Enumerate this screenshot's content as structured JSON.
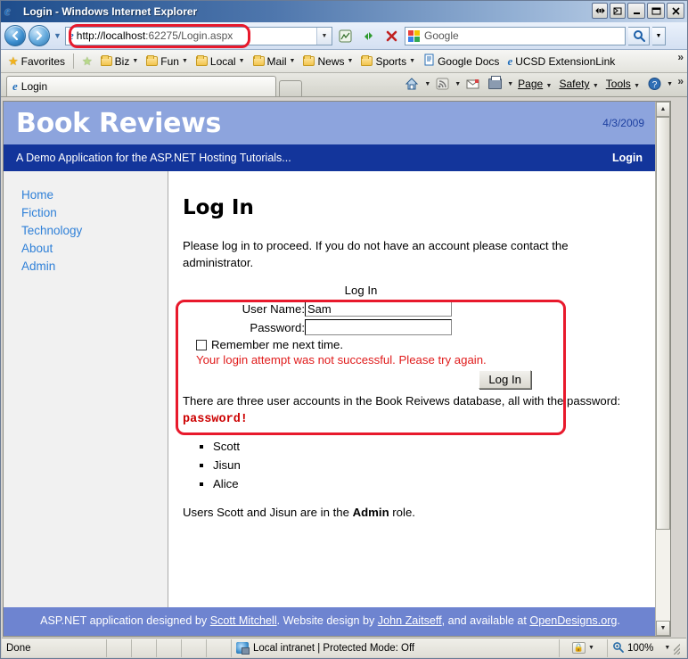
{
  "window": {
    "title": "Login - Windows Internet Explorer",
    "icon": "ie-icon",
    "buttons": {
      "restore_down": "restore-down",
      "min": "minimize",
      "max": "maximize",
      "close": "close"
    }
  },
  "browser": {
    "back_label": "Back",
    "forward_label": "Forward",
    "history_dropdown": "History",
    "address": {
      "scheme": "http://localhost",
      "rest": ":62275/Login.aspx",
      "full": "http://localhost:62275/Login.aspx"
    },
    "compat_button": "Compatibility View",
    "refresh_button": "Refresh",
    "stop_button": "Stop",
    "search": {
      "placeholder": "Google",
      "provider_icon": "google-icon",
      "go_label": "Search"
    },
    "favorites_label": "Favorites",
    "favorites": [
      {
        "label": "Biz",
        "icon": "folder-icon",
        "has_caret": true
      },
      {
        "label": "Fun",
        "icon": "folder-icon",
        "has_caret": true
      },
      {
        "label": "Local",
        "icon": "folder-icon",
        "has_caret": true
      },
      {
        "label": "Mail",
        "icon": "folder-icon",
        "has_caret": true
      },
      {
        "label": "News",
        "icon": "folder-icon",
        "has_caret": true
      },
      {
        "label": "Sports",
        "icon": "folder-icon",
        "has_caret": true
      },
      {
        "label": "Google Docs",
        "icon": "gdocs-icon",
        "has_caret": false
      },
      {
        "label": "UCSD ExtensionLink",
        "icon": "ie-icon",
        "has_caret": false
      }
    ],
    "overflow_chevron": "»",
    "tab_label": "Login",
    "new_tab_label": "New Tab",
    "commands": [
      {
        "label": "Page",
        "accel": "P"
      },
      {
        "label": "Safety",
        "accel": "S"
      },
      {
        "label": "Tools",
        "accel": "o"
      }
    ],
    "command_icons": [
      "home-icon",
      "feeds-icon",
      "mail-icon",
      "print-icon",
      "help-icon"
    ]
  },
  "site": {
    "title": "Book Reviews",
    "date": "4/3/2009",
    "tagline": "A Demo Application for the ASP.NET Hosting Tutorials...",
    "login_link": "Login",
    "nav": [
      {
        "label": "Home"
      },
      {
        "label": "Fiction"
      },
      {
        "label": "Technology"
      },
      {
        "label": "About"
      },
      {
        "label": "Admin"
      }
    ],
    "main": {
      "heading": "Log In",
      "intro": "Please log in to proceed. If you do not have an account please contact the administrator.",
      "form": {
        "legend": "Log In",
        "username_label": "User Name:",
        "username_value": "Sam",
        "password_label": "Password:",
        "password_value": "",
        "remember_label": "Remember me next time.",
        "error": "Your login attempt was not successful. Please try again.",
        "submit_label": "Log In"
      },
      "accounts_text_before": "There are three user accounts in the Book Reivews database, all with the password: ",
      "accounts_password": "password!",
      "accounts": [
        "Scott",
        "Jisun",
        "Alice"
      ],
      "roles_before": "Users Scott and Jisun are in the ",
      "roles_bold": "Admin",
      "roles_after": " role."
    },
    "footer": {
      "part1": "ASP.NET application designed by ",
      "link1": "Scott Mitchell",
      "part2": ". Website design by ",
      "link2": "John Zaitseff",
      "part3": ", and available at ",
      "link3": "OpenDesigns.org",
      "part4": "."
    }
  },
  "statusbar": {
    "status": "Done",
    "zone": "Local intranet | Protected Mode: Off",
    "zoom": "100%"
  },
  "colors": {
    "header_light": "#8da4dd",
    "header_dark": "#13359b",
    "footer": "#6e84d0",
    "link": "#2f80d8",
    "error": "#e01b1b",
    "annotation": "#e8192c"
  }
}
